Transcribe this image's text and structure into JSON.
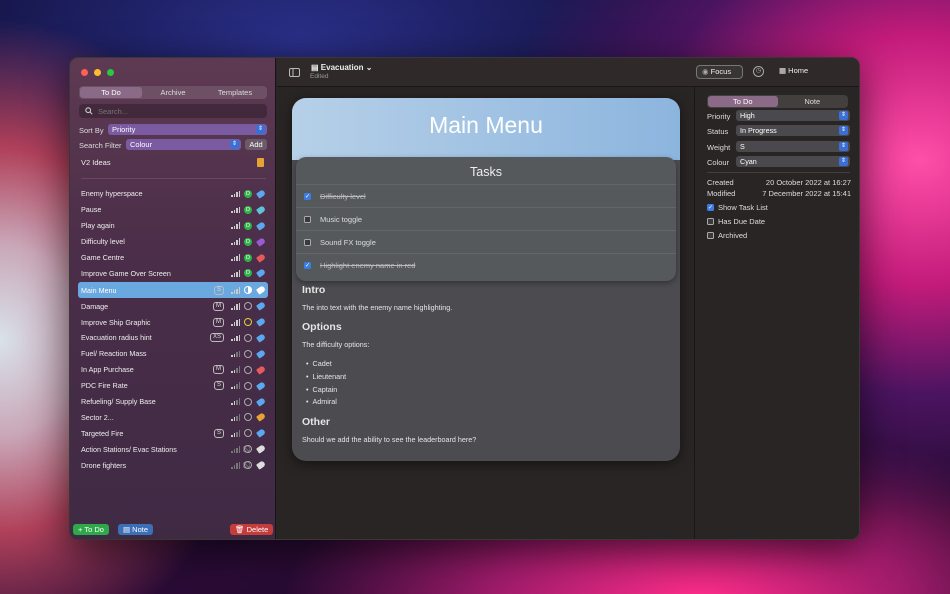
{
  "sidebar": {
    "tabs": [
      "To Do",
      "Archive",
      "Templates"
    ],
    "search_placeholder": "Search...",
    "sort_by_label": "Sort By",
    "sort_by_value": "Priority",
    "filter_label": "Search Filter",
    "filter_value": "Colour",
    "add_label": "Add",
    "group_title": "V2 Ideas",
    "items": [
      {
        "label": "Enemy hyperspace",
        "size": "",
        "level": 4,
        "status": "D",
        "status_color": "#2fb34a",
        "tag_color": "#5aa8f0"
      },
      {
        "label": "Pause",
        "size": "",
        "level": 4,
        "status": "D",
        "status_color": "#2fb34a",
        "tag_color": "#5ec2d8"
      },
      {
        "label": "Play again",
        "size": "",
        "level": 4,
        "status": "D",
        "status_color": "#2fb34a",
        "tag_color": "#5aa8f0"
      },
      {
        "label": "Difficulty level",
        "size": "",
        "level": 4,
        "status": "D",
        "status_color": "#2fb34a",
        "tag_color": "#9a5ad8"
      },
      {
        "label": "Game Centre",
        "size": "",
        "level": 4,
        "status": "D",
        "status_color": "#2fb34a",
        "tag_color": "#e65a5a"
      },
      {
        "label": "Improve Game Over Screen",
        "size": "",
        "level": 4,
        "status": "D",
        "status_color": "#2fb34a",
        "tag_color": "#5aa8f0"
      },
      {
        "label": "Main Menu",
        "size": "S",
        "level": 4,
        "status": "half",
        "status_color": "#ffffff",
        "tag_color": "#ffffff"
      },
      {
        "label": "Damage",
        "size": "M",
        "level": 4,
        "status": "open",
        "status_color": "",
        "tag_color": "#5aa8f0"
      },
      {
        "label": "Improve Ship Graphic",
        "size": "M",
        "level": 4,
        "status": "yellow",
        "status_color": "#d8d33a",
        "tag_color": "#5aa8f0"
      },
      {
        "label": "Evacuation radius hint",
        "size": "XS",
        "level": 4,
        "status": "open",
        "status_color": "",
        "tag_color": "#5aa8f0"
      },
      {
        "label": "Fuel/ Reaction Mass",
        "size": "",
        "level": 2,
        "status": "open",
        "status_color": "",
        "tag_color": "#5aa8f0"
      },
      {
        "label": "In App Purchase",
        "size": "M",
        "level": 2,
        "status": "open",
        "status_color": "",
        "tag_color": "#e65a5a"
      },
      {
        "label": "PDC Fire Rate",
        "size": "S",
        "level": 2,
        "status": "open",
        "status_color": "",
        "tag_color": "#5aa8f0"
      },
      {
        "label": "Refueling/ Supply Base",
        "size": "",
        "level": 2,
        "status": "open",
        "status_color": "",
        "tag_color": "#5aa8f0"
      },
      {
        "label": "Sector 2...",
        "size": "",
        "level": 2,
        "status": "open",
        "status_color": "",
        "tag_color": "#e7a233"
      },
      {
        "label": "Targeted Fire",
        "size": "S",
        "level": 2,
        "status": "open",
        "status_color": "",
        "tag_color": "#5aa8f0"
      },
      {
        "label": "Action Stations/ Evac Stations",
        "size": "",
        "level": 0,
        "status": "none",
        "status_color": "",
        "tag_color": "#dddddd"
      },
      {
        "label": "Drone fighters",
        "size": "",
        "level": 0,
        "status": "none",
        "status_color": "",
        "tag_color": "#dddddd"
      }
    ],
    "footer": {
      "todo": "To Do",
      "note": "Note",
      "delete": "Delete"
    }
  },
  "toolbar": {
    "doc_title": "Evacuation",
    "doc_status": "Edited",
    "focus": "Focus",
    "home": "Home"
  },
  "document": {
    "title": "Main Menu",
    "tasks_heading": "Tasks",
    "tasks": [
      {
        "text": "Difficulty level",
        "done": true
      },
      {
        "text": "Music toggle",
        "done": false
      },
      {
        "text": "Sound FX toggle",
        "done": false
      },
      {
        "text": "Highlight enemy name in red",
        "done": true
      }
    ],
    "intro_heading": "Intro",
    "intro_text": "The into text with the enemy name highlighting.",
    "options_heading": "Options",
    "options_text": "The difficulty options:",
    "options_list": [
      "Cadet",
      "Lieutenant",
      "Captain",
      "Admiral"
    ],
    "other_heading": "Other",
    "other_text": "Should we add the ability to see the leaderboard here?"
  },
  "inspector": {
    "tabs": [
      "To Do",
      "Note"
    ],
    "priority_label": "Priority",
    "priority": "High",
    "status_label": "Status",
    "status": "In Progress",
    "weight_label": "Weight",
    "weight": "S",
    "colour_label": "Colour",
    "colour": "Cyan",
    "created_label": "Created",
    "created": "20 October 2022 at 16:27",
    "modified_label": "Modified",
    "modified": "7 December 2022 at 15:41",
    "show_task_list": "Show Task List",
    "has_due_date": "Has Due Date",
    "archived": "Archived"
  }
}
